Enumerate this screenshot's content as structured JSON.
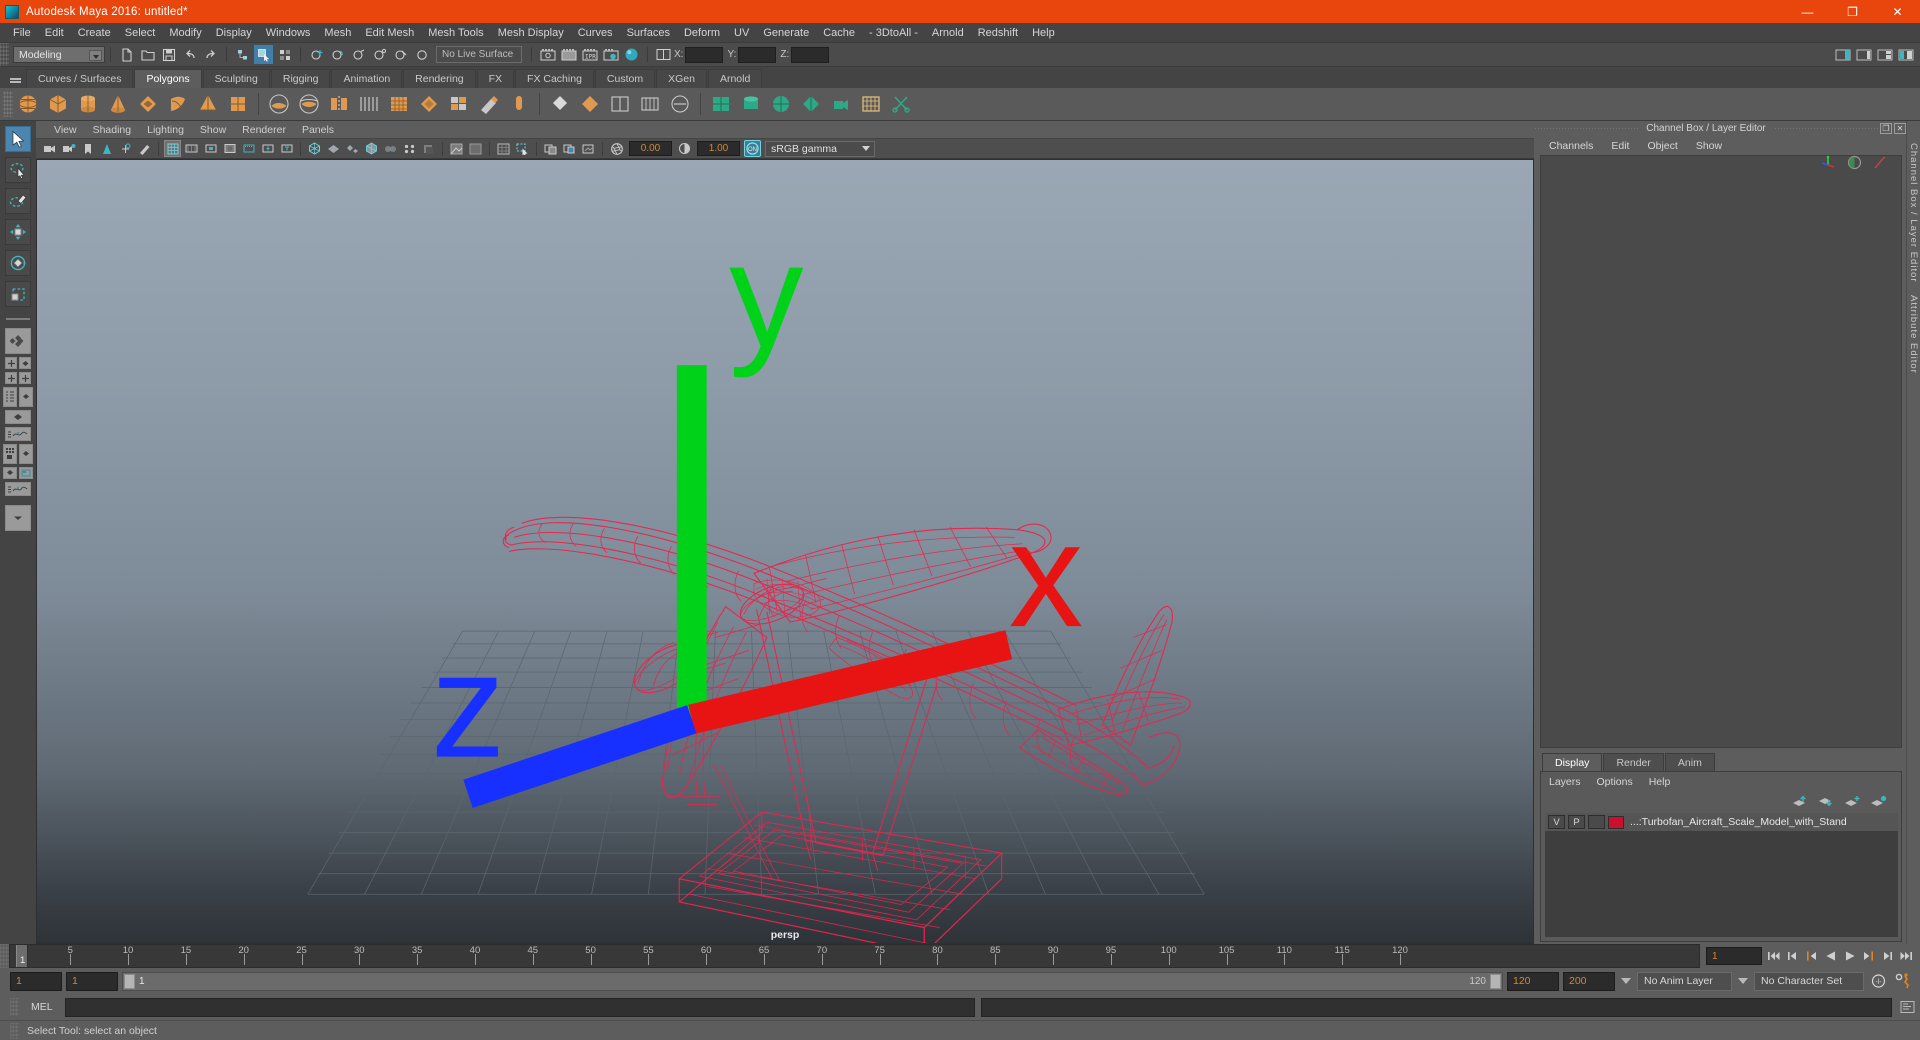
{
  "window": {
    "title": "Autodesk Maya 2016: untitled*",
    "minimize": "—",
    "maximize": "❐",
    "close": "✕"
  },
  "menubar": {
    "items": [
      {
        "label": "File"
      },
      {
        "label": "Edit"
      },
      {
        "label": "Create"
      },
      {
        "label": "Select"
      },
      {
        "label": "Modify"
      },
      {
        "label": "Display"
      },
      {
        "label": "Windows"
      },
      {
        "label": "Mesh"
      },
      {
        "label": "Edit Mesh"
      },
      {
        "label": "Mesh Tools"
      },
      {
        "label": "Mesh Display"
      },
      {
        "label": "Curves"
      },
      {
        "label": "Surfaces"
      },
      {
        "label": "Deform"
      },
      {
        "label": "UV"
      },
      {
        "label": "Generate"
      },
      {
        "label": "Cache"
      },
      {
        "label": "- 3DtoAll -"
      },
      {
        "label": "Arnold"
      },
      {
        "label": "Redshift"
      },
      {
        "label": "Help"
      }
    ]
  },
  "statusbar": {
    "mode": "Modeling",
    "live_surface": "No Live Surface",
    "coord_labels": {
      "x": "X:",
      "y": "Y:",
      "z": "Z:"
    },
    "coord_values": {
      "x": "",
      "y": "",
      "z": ""
    }
  },
  "shelf": {
    "tabs": [
      {
        "label": "Curves / Surfaces",
        "active": false
      },
      {
        "label": "Polygons",
        "active": true
      },
      {
        "label": "Sculpting",
        "active": false
      },
      {
        "label": "Rigging",
        "active": false
      },
      {
        "label": "Animation",
        "active": false
      },
      {
        "label": "Rendering",
        "active": false
      },
      {
        "label": "FX",
        "active": false
      },
      {
        "label": "FX Caching",
        "active": false
      },
      {
        "label": "Custom",
        "active": false
      },
      {
        "label": "XGen",
        "active": false
      },
      {
        "label": "Arnold",
        "active": false
      }
    ]
  },
  "viewport": {
    "menu": [
      {
        "label": "View"
      },
      {
        "label": "Shading"
      },
      {
        "label": "Lighting"
      },
      {
        "label": "Show"
      },
      {
        "label": "Renderer"
      },
      {
        "label": "Panels"
      }
    ],
    "exposure": "0.00",
    "gamma": "1.00",
    "color_mgmt_toggle": "ON",
    "view_transform": "sRGB gamma",
    "camera_label": "persp",
    "axis": {
      "x": "x",
      "y": "y",
      "z": "z"
    },
    "model_color": "#e8254f",
    "grid_color": "#5c6670"
  },
  "right_dock": {
    "panel_title": "Channel Box / Layer Editor",
    "undock_icon": "❐",
    "close_icon": "✕",
    "channel_menu": [
      {
        "label": "Channels"
      },
      {
        "label": "Edit"
      },
      {
        "label": "Object"
      },
      {
        "label": "Show"
      }
    ],
    "layer_tabs": [
      {
        "label": "Display",
        "active": true
      },
      {
        "label": "Render",
        "active": false
      },
      {
        "label": "Anim",
        "active": false
      }
    ],
    "layer_menu": [
      {
        "label": "Layers"
      },
      {
        "label": "Options"
      },
      {
        "label": "Help"
      }
    ],
    "layers": [
      {
        "visible": "V",
        "playback": "P",
        "type": "",
        "color": "#c9102e",
        "name": "...:Turbofan_Aircraft_Scale_Model_with_Stand"
      }
    ],
    "side_tabs": [
      {
        "label": "Channel Box / Layer Editor"
      },
      {
        "label": "Attribute Editor"
      }
    ]
  },
  "timeline": {
    "ticks": [
      5,
      10,
      15,
      20,
      25,
      30,
      35,
      40,
      45,
      50,
      55,
      60,
      65,
      70,
      75,
      80,
      85,
      90,
      95,
      100,
      105,
      110,
      115,
      120
    ],
    "range_start": 1,
    "range_end": 120,
    "current_frame": "1",
    "playhead_label": "1",
    "playback_buttons": [
      "go-to-start",
      "step-back-key",
      "step-back-frame",
      "play-backwards",
      "play-forwards",
      "step-forward-frame",
      "step-forward-key",
      "go-to-end"
    ]
  },
  "range_row": {
    "anim_start": "1",
    "range_start": "1",
    "slider_start": "1",
    "slider_end": "120",
    "range_end": "120",
    "anim_end": "200",
    "anim_layer": "No Anim Layer",
    "character_set": "No Character Set"
  },
  "command_line": {
    "label": "MEL",
    "value": "",
    "placeholder": ""
  },
  "status_line": {
    "message": "Select Tool: select an object"
  },
  "tool_box": {
    "tools": [
      {
        "name": "select-tool",
        "selected": true
      },
      {
        "name": "lasso-select-tool",
        "selected": false
      },
      {
        "name": "paint-select-tool",
        "selected": false
      },
      {
        "name": "move-tool",
        "selected": false
      },
      {
        "name": "rotate-tool",
        "selected": false
      },
      {
        "name": "scale-tool",
        "selected": false
      }
    ]
  },
  "colors": {
    "title_bar": "#e8460c",
    "accent_blue": "#4a86b0",
    "shelf_orange": "#d9883f",
    "teal": "#3fb5bf",
    "field_orange": "#d08a30"
  }
}
